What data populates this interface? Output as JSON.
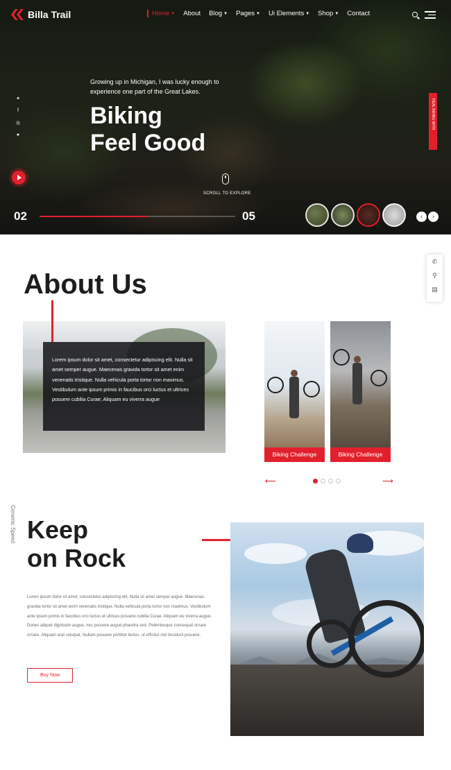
{
  "brand": {
    "name": "Billa Trail",
    "accent": "#e2202c"
  },
  "nav": {
    "items": [
      {
        "label": "Home",
        "active": true,
        "caret": true
      },
      {
        "label": "About",
        "active": false,
        "caret": false
      },
      {
        "label": "Blog",
        "active": false,
        "caret": true
      },
      {
        "label": "Pages",
        "active": false,
        "caret": true
      },
      {
        "label": "Ui Elements",
        "active": false,
        "caret": true
      },
      {
        "label": "Shop",
        "active": false,
        "caret": true
      },
      {
        "label": "Contact",
        "active": false,
        "caret": false
      }
    ]
  },
  "hero": {
    "subtitle": "Growing up in Michigan, I was lucky enough to experience one part of the Great Lakes.",
    "title_line1": "Biking",
    "title_line2": "Feel Good",
    "scroll_text": "SCROLL TO EXPLORE",
    "side_tab": "REAL BIKING WITH",
    "slide_current": "02",
    "slide_total": "05",
    "progress": 0.55,
    "social_icons": [
      "twitter-icon",
      "facebook-icon",
      "instagram-icon",
      "snapchat-icon"
    ]
  },
  "contact_float": {
    "icons": [
      "phone-icon",
      "location-icon",
      "store-icon"
    ]
  },
  "about": {
    "title": "About Us",
    "text": "Lorem ipsum dolor sit amet, consectetur adipiscing elit. Nulla sit amet semper augue. Maecenas gravida tortor sit amet enim venenatis tristique. Nulla vehicula porta tortor non maximus. Vestibulum ante ipsum primis in faucibus orci luctus et ultrices posuere cubilia Curae; Aliquam eu viverra augue",
    "cards": [
      {
        "label": "Biking Challenge"
      },
      {
        "label": "Biking Challenge"
      }
    ],
    "active_dot": 0,
    "dot_count": 4
  },
  "keep": {
    "side_label": "Ceramic Speed",
    "title_line1": "Keep",
    "title_line2": "on Rock",
    "text": "Lorem ipsum dolor sit amet, consectetur adipiscing elit. Nulla sit amet semper augue. Maecenas gravida tortor sit amet enim venenatis tristique. Nulla vehicula porta tortor non maximus. Vestibulum ante ipsum primis in faucibus orci luctus et ultrices posuere cubilia Curae. Aliquam eu viverra augue. Donec aliquet dignissim augue, nec posuere augue pharetra sed. Pellentesque consequat ornare ornare. Aliquam erat volutpat. Nullam posuere porttitor lectus, ut efficitur nisl tincidunt posuere.",
    "button_label": "Buy Now"
  }
}
